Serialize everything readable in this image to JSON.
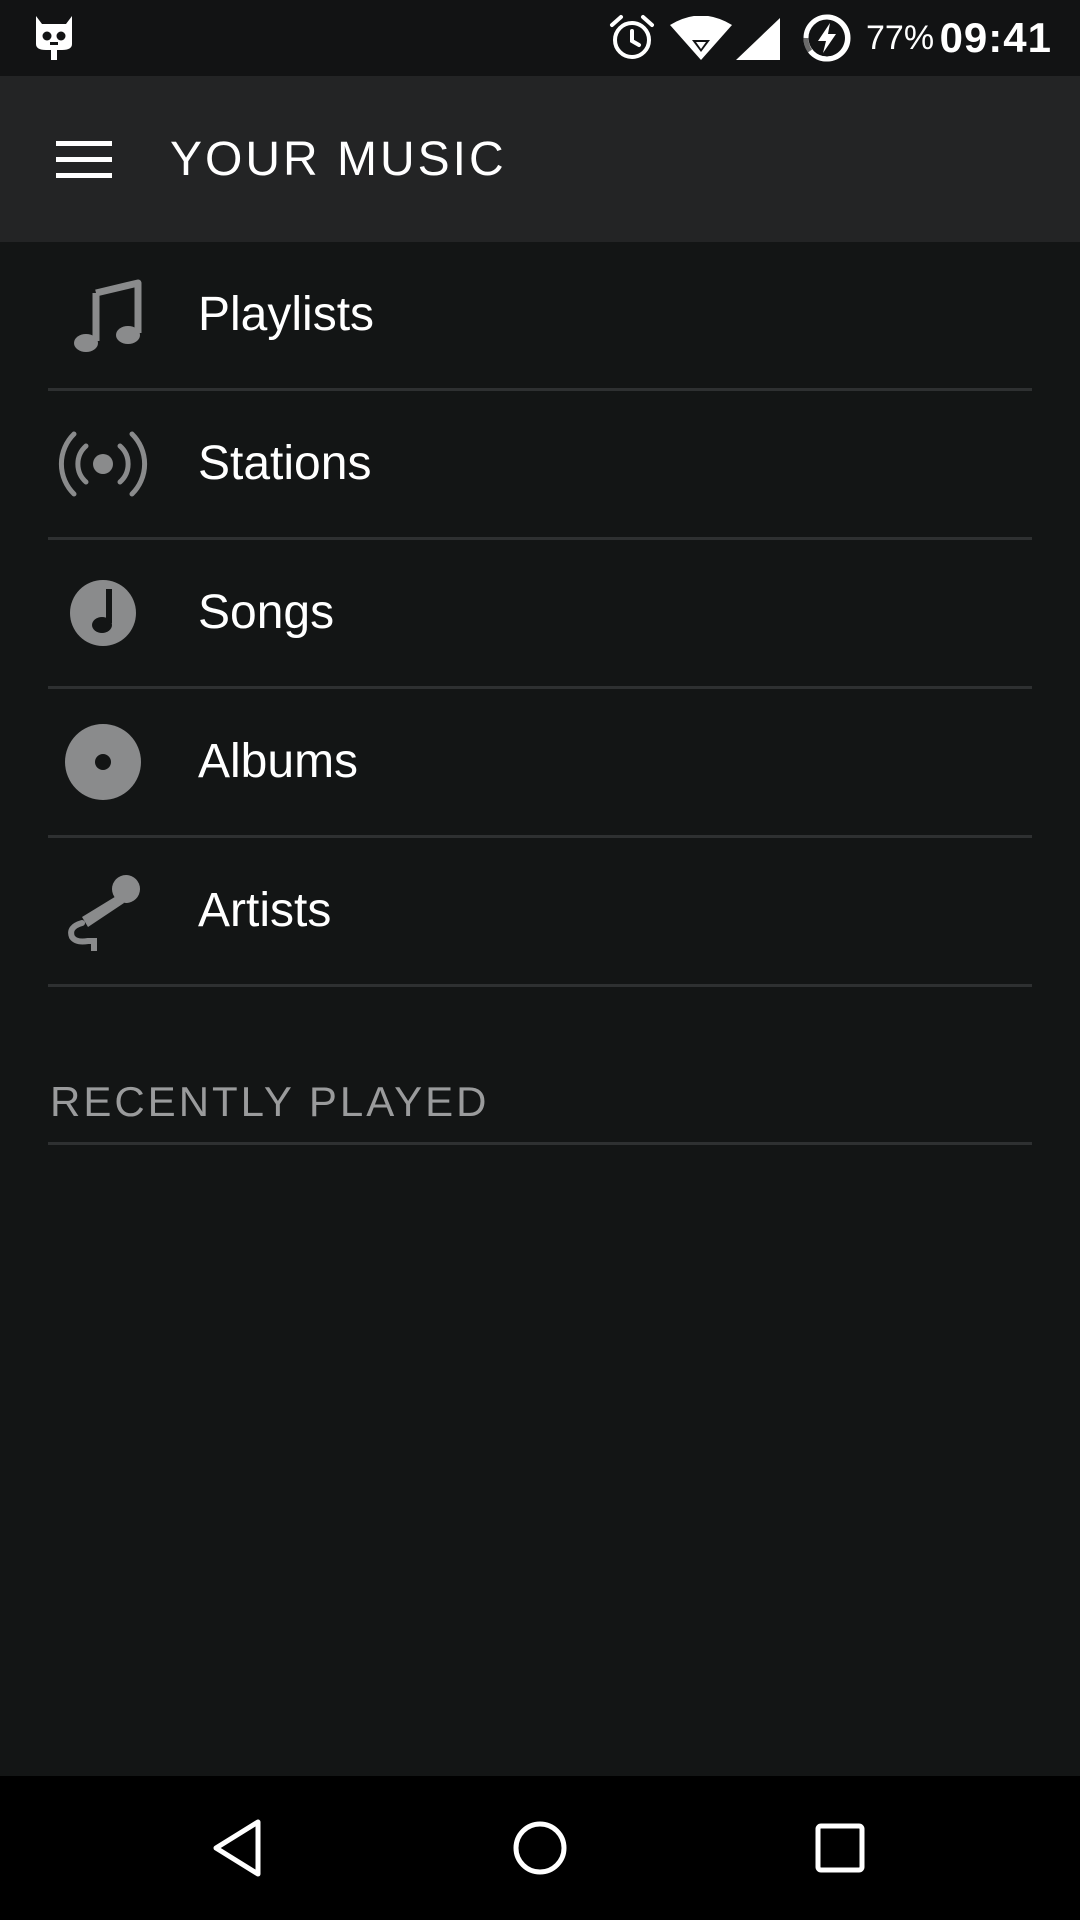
{
  "status_bar": {
    "battery_percent": "77%",
    "time": "09:41",
    "icons": [
      "app-notification-icon",
      "alarm-icon",
      "wifi-icon",
      "cell-signal-icon",
      "battery-charging-icon"
    ]
  },
  "app_bar": {
    "title": "YOUR MUSIC",
    "menu_icon": "hamburger-menu-icon"
  },
  "nav_items": [
    {
      "label": "Playlists",
      "icon": "music-note-icon"
    },
    {
      "label": "Stations",
      "icon": "radio-broadcast-icon"
    },
    {
      "label": "Songs",
      "icon": "song-note-icon"
    },
    {
      "label": "Albums",
      "icon": "album-disc-icon"
    },
    {
      "label": "Artists",
      "icon": "microphone-icon"
    }
  ],
  "sections": {
    "recently_played": "RECENTLY PLAYED"
  },
  "system_nav": {
    "icons": [
      "back-icon",
      "home-icon",
      "recents-icon"
    ]
  },
  "colors": {
    "background": "#131515",
    "app_bar": "#232425",
    "icon_gray": "#8a8b8c",
    "divider": "#2e3031",
    "section_text": "#9a9b9c"
  }
}
